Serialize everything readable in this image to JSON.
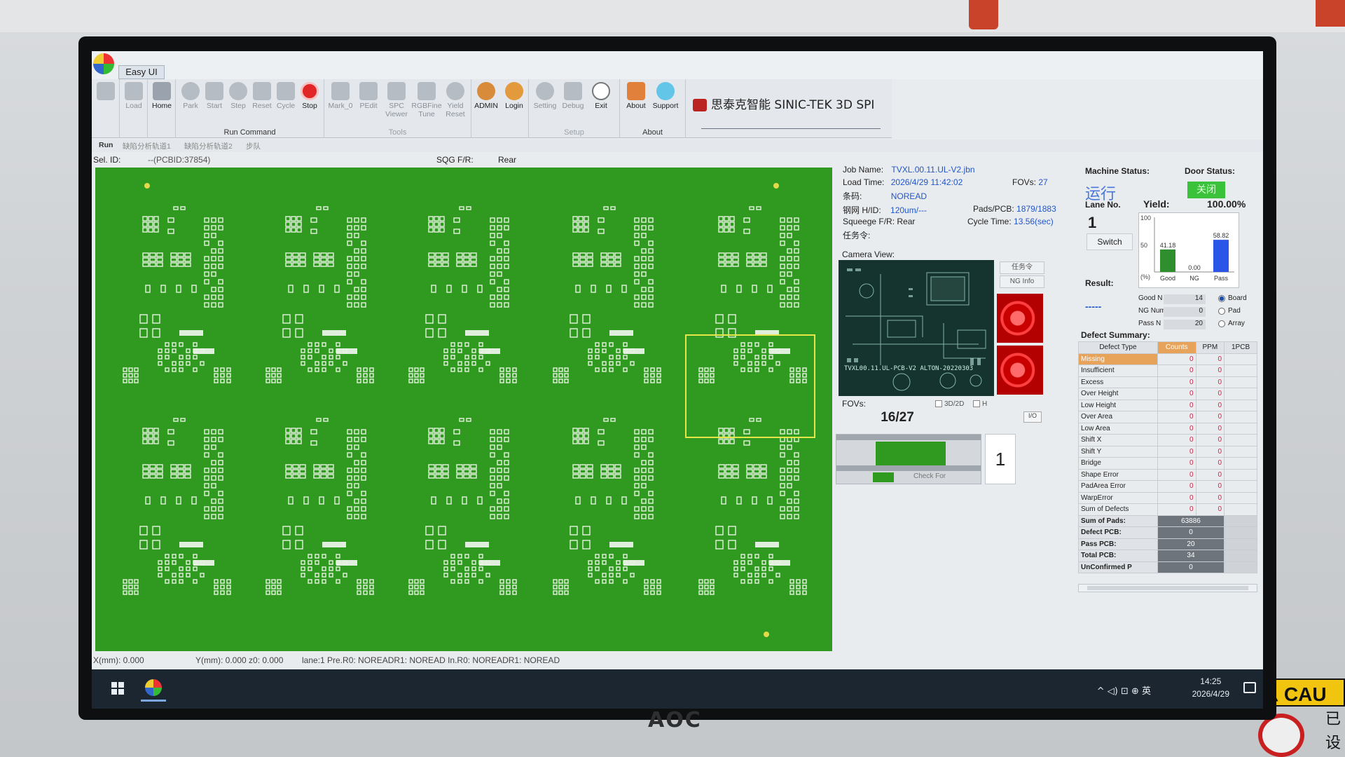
{
  "app": {
    "tab": "Easy UI",
    "brand_text": "思泰克智能 SINIC-TEK 3D SPI",
    "monitor_brand": "AOC"
  },
  "ribbon": {
    "job": [
      {
        "label": "Load",
        "icon": "folder-icon"
      }
    ],
    "home": {
      "label": "Home",
      "icon": "home-icon"
    },
    "run": [
      {
        "label": "Park",
        "icon": "park-icon"
      },
      {
        "label": "Start",
        "icon": "play-icon"
      },
      {
        "label": "Step",
        "icon": "step-icon"
      },
      {
        "label": "Reset",
        "icon": "reset-icon"
      },
      {
        "label": "Cycle",
        "icon": "cycle-icon"
      },
      {
        "label": "Stop",
        "icon": "stop-icon"
      }
    ],
    "run_group_label": "Run Command",
    "tools": [
      {
        "label": "Mark_0",
        "icon": "mark-icon"
      },
      {
        "label": "PEdit",
        "icon": "edit-icon"
      },
      {
        "label": "SPC Viewer",
        "icon": "chart-icon"
      },
      {
        "label": "RGBFine Tune",
        "icon": "rgb-icon"
      },
      {
        "label": "Yield Reset",
        "icon": "clock-icon"
      }
    ],
    "tools_group_label": "Tools",
    "user": [
      {
        "label": "ADMIN",
        "icon": "users-icon"
      },
      {
        "label": "Login",
        "icon": "user-icon"
      }
    ],
    "setup": [
      {
        "label": "Setting",
        "icon": "gear-icon"
      },
      {
        "label": "Debug",
        "icon": "debug-icon"
      },
      {
        "label": "Exit",
        "icon": "exit-icon"
      }
    ],
    "setup_group_label": "Setup",
    "about": [
      {
        "label": "About",
        "icon": "about-icon"
      },
      {
        "label": "Support",
        "icon": "support-icon"
      }
    ],
    "about_group_label": "About"
  },
  "subbar": {
    "run": "Run",
    "tab1": "缺陷分析轨道1",
    "tab2": "缺陷分析轨道2",
    "tab3": "步队"
  },
  "selbar": {
    "sel_id_label": "Sel. ID:",
    "sel_id_value": "--(PCBID:37854)",
    "sqg_label": "SQG F/R:",
    "sqg_value": "Rear"
  },
  "info": {
    "job_name_label": "Job Name:",
    "job_name": "TVXL.00.11.UL-V2.jbn",
    "load_time_label": "Load Time:",
    "load_time": "2026/4/29 11:42:02",
    "fovs_label": "FOVs:",
    "fovs": "27",
    "barcode_label": "条码:",
    "barcode": "NOREAD",
    "stencil_label": "钢网 H/ID:",
    "stencil": "120um/---",
    "pads_label": "Pads/PCB:",
    "pads": "1879/1883",
    "squeegee_label": "Squeege F/R:",
    "squeegee": "Rear",
    "cycle_label": "Cycle Time:",
    "cycle": "13.56(sec)",
    "task_label": "任务令:"
  },
  "camera": {
    "label": "Camera View:",
    "pcb_text": "TVXL00.11.UL-PCB-V2  ALTON-20220303",
    "btn_task": "任务令",
    "btn_ng": "NG Info",
    "fovs_label": "FOVs:",
    "fovs_value": "16/27",
    "chk_3d": "3D/2D",
    "chk_h": "H",
    "io": "I/O",
    "check_for": "Check For",
    "lane_box": "1"
  },
  "machine": {
    "status_label": "Machine Status:",
    "status_value": "运行",
    "door_label": "Door Status:",
    "door_value": "关闭",
    "lane_label": "Lane No.",
    "lane_value": "1",
    "switch": "Switch",
    "yield_label": "Yield:",
    "yield_value": "100.00%",
    "result_label": "Result:",
    "result_value": "-----",
    "good_label": "Good N",
    "good_value": "14",
    "ng_label": "NG Num",
    "ng_value": "0",
    "pass_label": "Pass N",
    "pass_value": "20",
    "radio_board": "Board",
    "radio_pad": "Pad",
    "radio_array": "Array"
  },
  "chart_data": {
    "type": "bar",
    "categories": [
      "Good",
      "NG",
      "Pass"
    ],
    "values": [
      41.18,
      0.0,
      58.82
    ],
    "ylim": [
      0,
      100
    ],
    "yticks": [
      "100",
      "50",
      "(%)"
    ],
    "colors": [
      "#2f8f2f",
      "#2f8f2f",
      "#2b55e6"
    ]
  },
  "defects": {
    "label": "Defect Summary:",
    "headers": [
      "Defect Type",
      "Counts",
      "PPM",
      "1PCB"
    ],
    "rows": [
      {
        "type": "Missing",
        "counts": "0",
        "ppm": "0"
      },
      {
        "type": "Insufficient",
        "counts": "0",
        "ppm": "0"
      },
      {
        "type": "Excess",
        "counts": "0",
        "ppm": "0"
      },
      {
        "type": "Over Height",
        "counts": "0",
        "ppm": "0"
      },
      {
        "type": "Low Height",
        "counts": "0",
        "ppm": "0"
      },
      {
        "type": "Over Area",
        "counts": "0",
        "ppm": "0"
      },
      {
        "type": "Low Area",
        "counts": "0",
        "ppm": "0"
      },
      {
        "type": "Shift X",
        "counts": "0",
        "ppm": "0"
      },
      {
        "type": "Shift Y",
        "counts": "0",
        "ppm": "0"
      },
      {
        "type": "Bridge",
        "counts": "0",
        "ppm": "0"
      },
      {
        "type": "Shape Error",
        "counts": "0",
        "ppm": "0"
      },
      {
        "type": "PadArea Error",
        "counts": "0",
        "ppm": "0"
      },
      {
        "type": "WarpError",
        "counts": "0",
        "ppm": "0"
      },
      {
        "type": "Sum of Defects",
        "counts": "0",
        "ppm": "0"
      }
    ],
    "summary": [
      {
        "label": "Sum of Pads:",
        "value": "63886"
      },
      {
        "label": "Defect PCB:",
        "value": "0"
      },
      {
        "label": "Pass PCB:",
        "value": "20"
      },
      {
        "label": "Total PCB:",
        "value": "34"
      },
      {
        "label": "UnConfirmed P",
        "value": "0"
      }
    ]
  },
  "statusbar": {
    "x": "X(mm): 0.000",
    "y": "Y(mm): 0.000 z0: 0.000",
    "lane": "lane:1 Pre.R0: NOREADR1: NOREAD  In.R0: NOREADR1: NOREAD"
  },
  "taskbar": {
    "tray": "^ ◁) ⊡ ⊕ 英",
    "time": "14:25",
    "date": "2026/4/29"
  },
  "warning_sign": {
    "text": "CAU",
    "side_text": "已\n设"
  }
}
